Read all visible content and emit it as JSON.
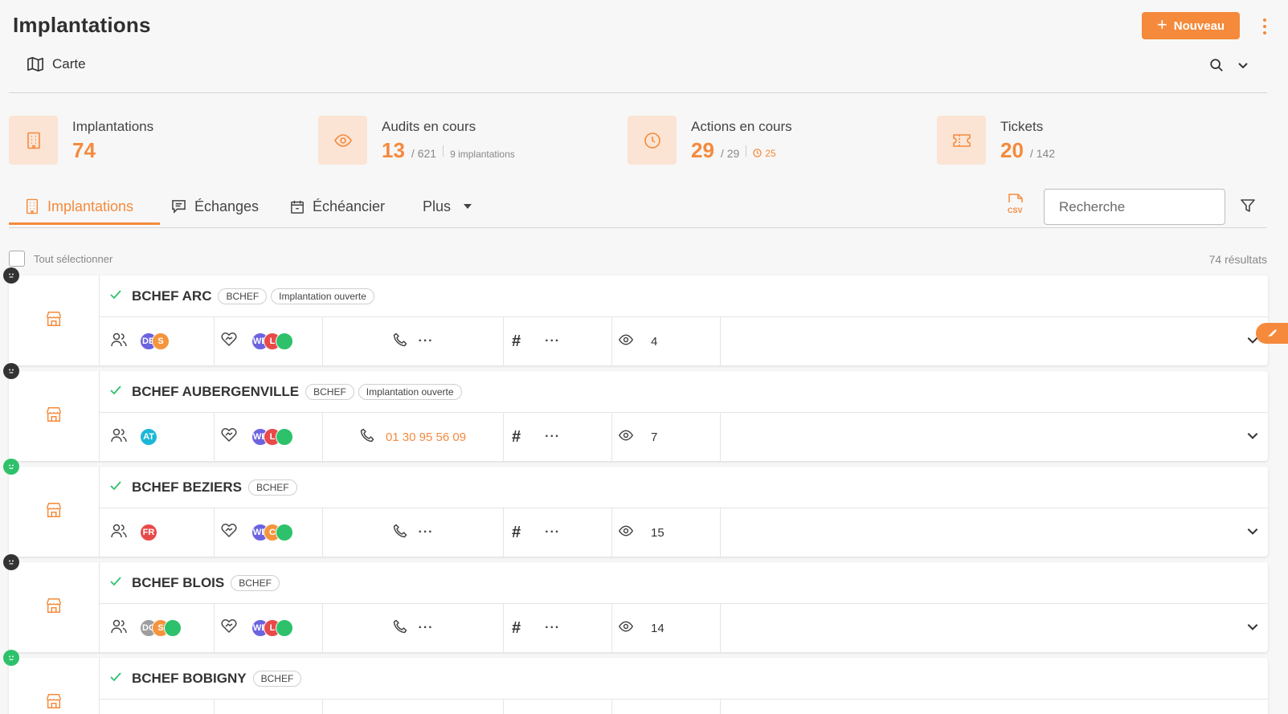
{
  "header": {
    "title": "Implantations",
    "new_button": "Nouveau"
  },
  "viewbar": {
    "view_label": "Carte"
  },
  "stats": [
    {
      "label": "Implantations",
      "value": "74",
      "icon": "building-icon"
    },
    {
      "label": "Audits en cours",
      "value": "13",
      "total": "/ 621",
      "extra": "9 implantations",
      "icon": "eye-icon"
    },
    {
      "label": "Actions en cours",
      "value": "29",
      "total": "/ 29",
      "extra": "25",
      "icon": "clock-icon"
    },
    {
      "label": "Tickets",
      "value": "20",
      "total": "/ 142",
      "icon": "ticket-icon"
    }
  ],
  "tabs": {
    "t1": "Implantations",
    "t2": "Échanges",
    "t3": "Échéancier",
    "t4": "Plus"
  },
  "search": {
    "placeholder": "Recherche"
  },
  "selection": {
    "label": "Tout sélectionner",
    "results": "74 résultats"
  },
  "colors": {
    "accent": "#f58a3c",
    "accent_light": "#fbe4d4",
    "mood_neutral": "#333333",
    "mood_happy": "#2ec16b"
  },
  "rows": [
    {
      "name": "BCHEF ARC",
      "tags": [
        "BCHEF",
        "Implantation ouverte"
      ],
      "mood": "neutral",
      "users": [
        {
          "initials": "DB",
          "color": "#6c63e0"
        },
        {
          "initials": "S",
          "color": "#f5943c"
        }
      ],
      "partners": [
        {
          "initials": "WB",
          "color": "#6c63e0"
        },
        {
          "initials": "L",
          "color": "#e84a4a"
        },
        {
          "initials": "",
          "color": "#2ec16b"
        }
      ],
      "phone": "",
      "visits": "4"
    },
    {
      "name": "BCHEF AUBERGENVILLE",
      "tags": [
        "BCHEF",
        "Implantation ouverte"
      ],
      "mood": "neutral",
      "users": [
        {
          "initials": "AT",
          "color": "#1cb7d6"
        }
      ],
      "partners": [
        {
          "initials": "WB",
          "color": "#6c63e0"
        },
        {
          "initials": "L",
          "color": "#e84a4a"
        },
        {
          "initials": "",
          "color": "#2ec16b"
        }
      ],
      "phone": "01 30 95 56 09",
      "visits": "7"
    },
    {
      "name": "BCHEF BEZIERS",
      "tags": [
        "BCHEF"
      ],
      "mood": "happy",
      "users": [
        {
          "initials": "FR",
          "color": "#e84a4a"
        }
      ],
      "partners": [
        {
          "initials": "WB",
          "color": "#6c63e0"
        },
        {
          "initials": "C",
          "color": "#f5943c"
        },
        {
          "initials": "",
          "color": "#2ec16b"
        }
      ],
      "phone": "",
      "visits": "15"
    },
    {
      "name": "BCHEF BLOIS",
      "tags": [
        "BCHEF"
      ],
      "mood": "neutral",
      "users": [
        {
          "initials": "DC",
          "color": "#9e9e9e"
        },
        {
          "initials": "S",
          "color": "#f5943c"
        },
        {
          "initials": "",
          "color": "#2ec16b"
        }
      ],
      "partners": [
        {
          "initials": "WB",
          "color": "#6c63e0"
        },
        {
          "initials": "L",
          "color": "#e84a4a"
        },
        {
          "initials": "",
          "color": "#2ec16b"
        }
      ],
      "phone": "",
      "visits": "14"
    },
    {
      "name": "BCHEF BOBIGNY",
      "tags": [
        "BCHEF"
      ],
      "mood": "happy",
      "users": [],
      "partners": [],
      "phone": "",
      "visits": ""
    }
  ]
}
